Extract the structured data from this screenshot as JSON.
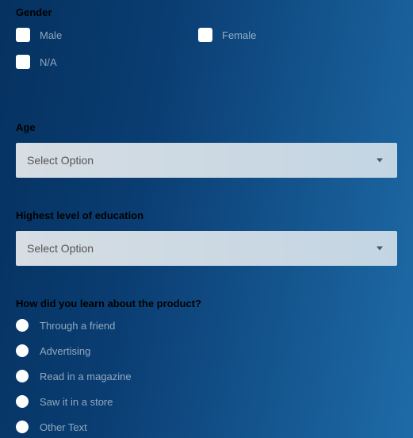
{
  "gender": {
    "title": "Gender",
    "options": [
      {
        "label": "Male"
      },
      {
        "label": "Female"
      },
      {
        "label": "N/A"
      }
    ]
  },
  "age": {
    "title": "Age",
    "placeholder": "Select Option"
  },
  "education": {
    "title": "Highest level of education",
    "placeholder": "Select Option"
  },
  "learn": {
    "title": "How did you learn about the product?",
    "options": [
      {
        "label": "Through a friend"
      },
      {
        "label": "Advertising"
      },
      {
        "label": "Read in a magazine"
      },
      {
        "label": "Saw it in a store"
      },
      {
        "label": "Other Text"
      }
    ]
  }
}
